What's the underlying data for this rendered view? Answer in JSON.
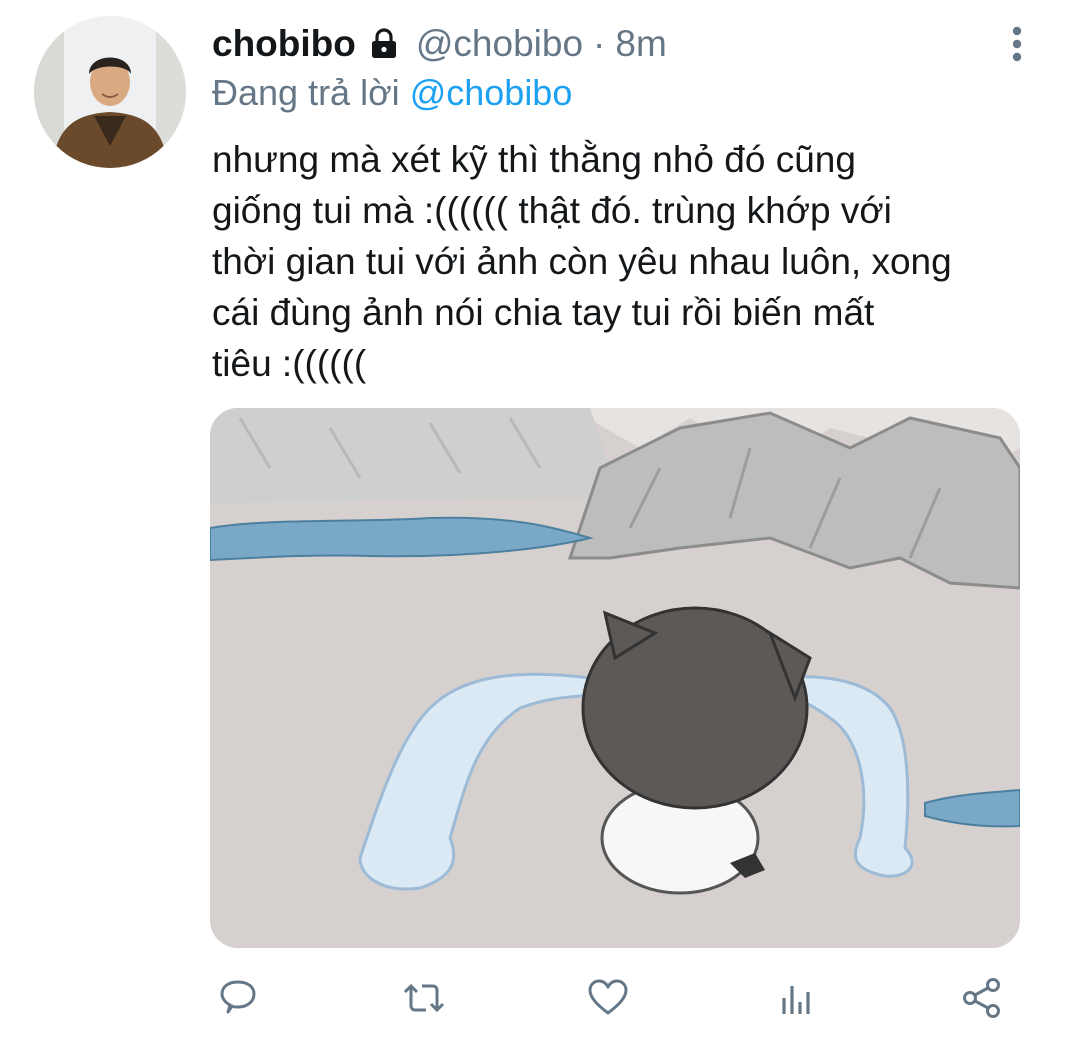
{
  "tweet": {
    "display_name": "chobibo",
    "handle": "@chobibo",
    "separator": "·",
    "time": "8m",
    "reply_prefix": "Đang trả lời",
    "reply_to": "@chobibo",
    "text_lines": [
      "nhưng mà xét kỹ thì thằng nhỏ đó cũng",
      "giống tui mà :(((((( thật đó. trùng khớp với",
      "thời gian tui với ảnh còn yêu nhau luôn, xong",
      "cái đùng ảnh nói chia tay tui rồi biến mất",
      "tiêu :(((((("
    ]
  },
  "icons": {
    "lock": "lock-icon",
    "more": "more-vertical-icon",
    "reply": "comment-icon",
    "retweet": "retweet-icon",
    "like": "heart-icon",
    "analytics": "analytics-icon",
    "share": "share-icon"
  },
  "colors": {
    "secondary_text": "#657786",
    "mention": "#1da1f2",
    "primary_text": "#14171a"
  }
}
